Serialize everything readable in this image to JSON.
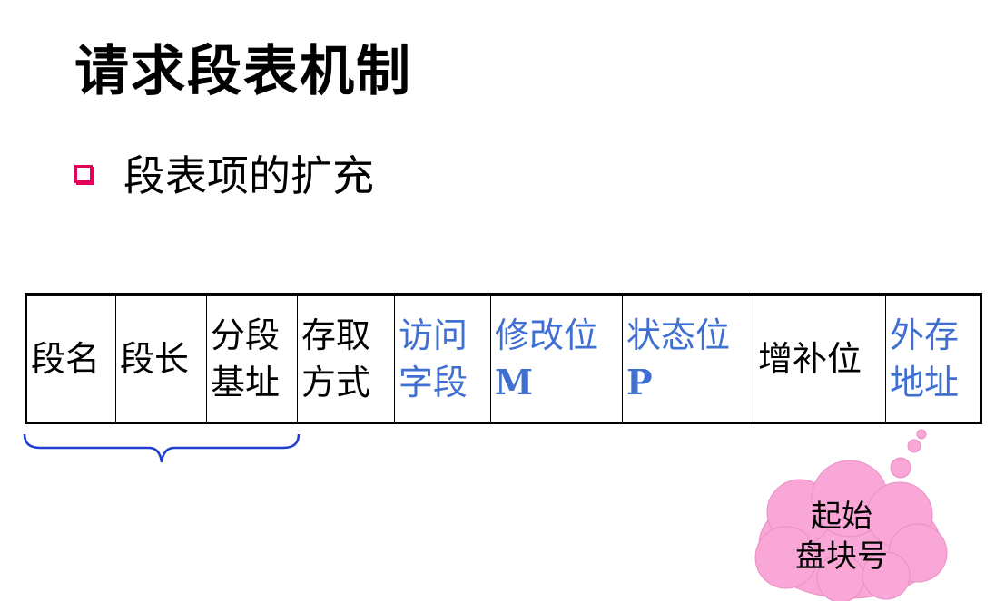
{
  "slide": {
    "title": "请求段表机制",
    "bullet": "段表项的扩充"
  },
  "table": {
    "cells": [
      {
        "line1": "段名",
        "line2": "",
        "color": "#000000"
      },
      {
        "line1": "段长",
        "line2": "",
        "color": "#000000"
      },
      {
        "line1": "分段",
        "line2": "基址",
        "color": "#000000"
      },
      {
        "line1": "存取",
        "line2": "方式",
        "color": "#000000"
      },
      {
        "line1": "访问",
        "line2": "字段",
        "color": "#3f6fd0"
      },
      {
        "line1": "修改位",
        "line2": "M",
        "color": "#3f6fd0"
      },
      {
        "line1": "状态位",
        "line2": "P",
        "color": "#3f6fd0"
      },
      {
        "line1": "增补位",
        "line2": "",
        "color": "#000000"
      },
      {
        "line1": "外存",
        "line2": "地址",
        "color": "#3f6fd0"
      }
    ]
  },
  "callout": {
    "line1": "起始",
    "line2": "盘块号",
    "fill": "#f9a7d6"
  },
  "colors": {
    "accent_bullet": "#e2005a",
    "brace": "#1f3fd0",
    "blue_text": "#3f6fd0"
  }
}
